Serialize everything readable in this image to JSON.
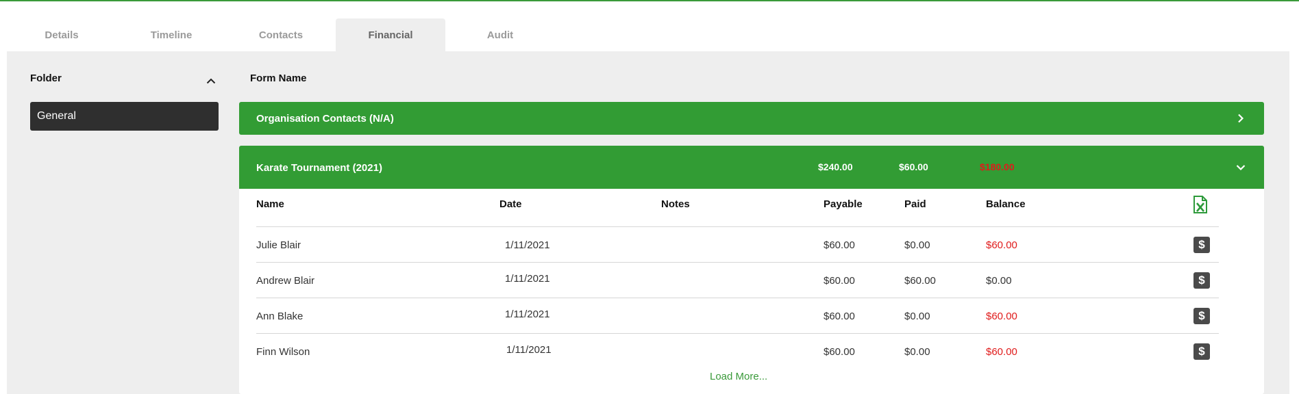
{
  "tabs": [
    {
      "label": "Details"
    },
    {
      "label": "Timeline"
    },
    {
      "label": "Contacts"
    },
    {
      "label": "Financial"
    },
    {
      "label": "Audit"
    }
  ],
  "active_tab": "Financial",
  "folder": {
    "title": "Folder",
    "items": [
      {
        "label": "General"
      }
    ]
  },
  "form_name_header": "Form Name",
  "forms": [
    {
      "title": "Organisation Contacts (N/A)"
    },
    {
      "title": "Karate Tournament (2021)",
      "payable": "$240.00",
      "paid": "$60.00",
      "balance": "$180.00",
      "columns": {
        "name": "Name",
        "date": "Date",
        "notes": "Notes",
        "payable": "Payable",
        "paid": "Paid",
        "balance": "Balance"
      },
      "rows": [
        {
          "name": "Julie Blair",
          "date": "1/11/2021",
          "notes": "",
          "payable": "$60.00",
          "paid": "$0.00",
          "balance": "$60.00"
        },
        {
          "name": "Andrew Blair",
          "date": "1/11/2021",
          "notes": "",
          "payable": "$60.00",
          "paid": "$60.00",
          "balance": "$0.00"
        },
        {
          "name": "Ann Blake",
          "date": "1/11/2021",
          "notes": "",
          "payable": "$60.00",
          "paid": "$0.00",
          "balance": "$60.00"
        },
        {
          "name": "Finn Wilson",
          "date": "1/11/2021",
          "notes": "",
          "payable": "$60.00",
          "paid": "$0.00",
          "balance": "$60.00"
        }
      ],
      "load_more": "Load More..."
    }
  ],
  "icons": {
    "folder_toggle": "chevron-up-icon",
    "collapsed": "chevron-right-icon",
    "expanded": "chevron-down-icon",
    "export": "excel-icon",
    "payment": "dollar-icon"
  },
  "colors": {
    "brand_green": "#329c34",
    "balance_red": "#e01b1b",
    "folder_selected": "#2f2f2f"
  }
}
